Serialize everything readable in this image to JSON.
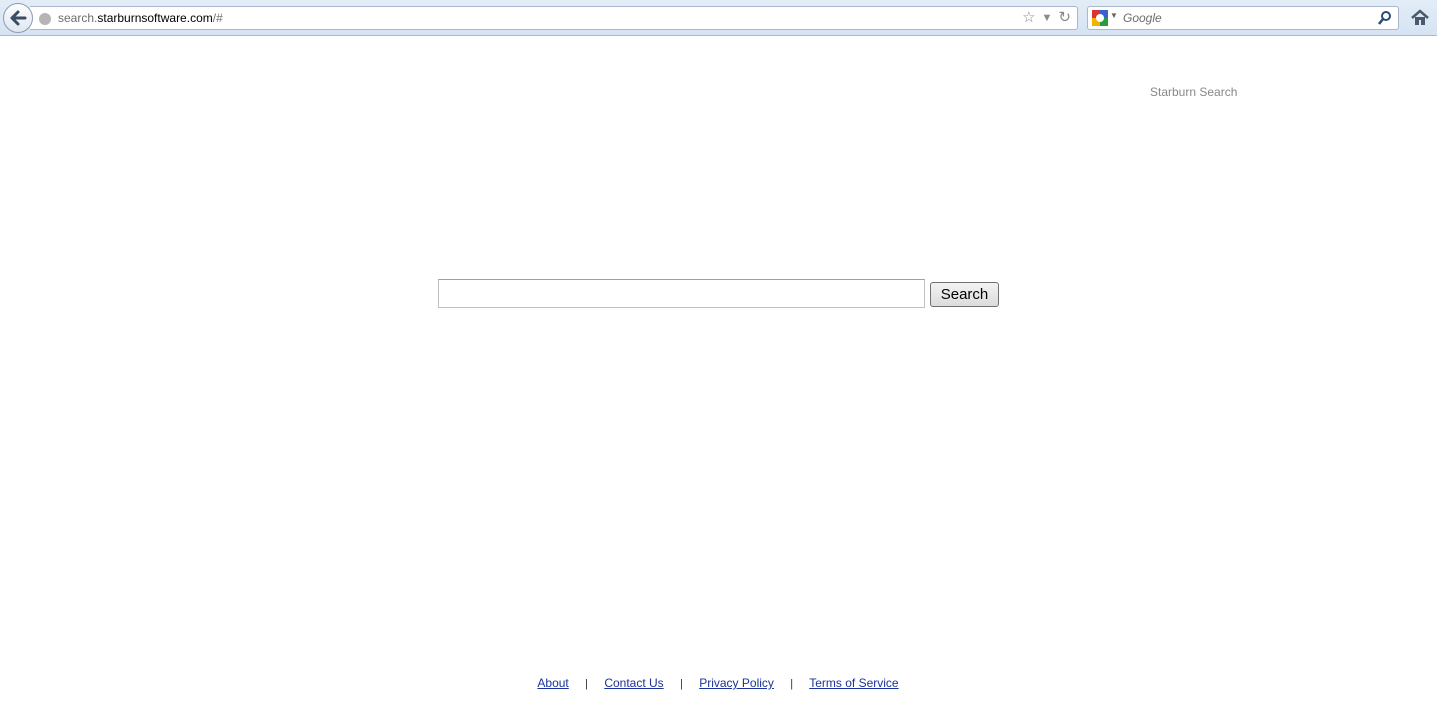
{
  "browser": {
    "url_prefix": "search.",
    "url_domain": "starburnsoftware.com",
    "url_suffix": "/#",
    "search_engine_placeholder": "Google"
  },
  "page": {
    "brand": "Starburn Search",
    "search_button": "Search",
    "footer_links": [
      "About",
      "Contact Us",
      "Privacy Policy",
      "Terms of Service"
    ],
    "separator": "|"
  }
}
